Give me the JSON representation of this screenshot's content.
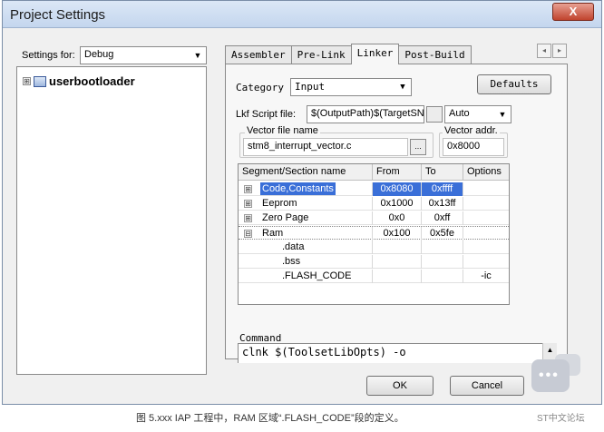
{
  "window": {
    "title": "Project Settings",
    "close_glyph": "X"
  },
  "settings_for": {
    "label": "Settings for:",
    "value": "Debug"
  },
  "tree": {
    "expander": "⊞",
    "root": "userbootloader"
  },
  "tabs": [
    {
      "label": "Assembler"
    },
    {
      "label": "Pre-Link"
    },
    {
      "label": "Linker"
    },
    {
      "label": "Post-Build"
    }
  ],
  "tab_scroll": {
    "left": "◂",
    "right": "▸"
  },
  "linker": {
    "category_label": "Category",
    "category_value": "Input",
    "defaults_button": "Defaults",
    "lkf_label": "Lkf Script file:",
    "lkf_value": "$(OutputPath)$(TargetSName",
    "lkf_mode": "Auto",
    "vector_file_label": "Vector file name",
    "vector_file_value": "stm8_interrupt_vector.c",
    "browse_label": "...",
    "vector_addr_label": "Vector addr.",
    "vector_addr_value": "0x8000"
  },
  "segments": {
    "headers": [
      "Segment/Section name",
      "From",
      "To",
      "Options"
    ],
    "rows": [
      {
        "exp": "⊞",
        "name": "Code,Constants",
        "from": "0x8080",
        "to": "0xffff",
        "opt": ""
      },
      {
        "exp": "⊞",
        "name": "Eeprom",
        "from": "0x1000",
        "to": "0x13ff",
        "opt": ""
      },
      {
        "exp": "⊞",
        "name": "Zero Page",
        "from": "0x0",
        "to": "0xff",
        "opt": ""
      },
      {
        "exp": "⊟",
        "name": "Ram",
        "from": "0x100",
        "to": "0x5fe",
        "opt": ""
      },
      {
        "exp": "",
        "name": ".data",
        "from": "",
        "to": "",
        "opt": ""
      },
      {
        "exp": "",
        "name": ".bss",
        "from": "",
        "to": "",
        "opt": ""
      },
      {
        "exp": "",
        "name": ".FLASH_CODE",
        "from": "",
        "to": "",
        "opt": "-ic"
      }
    ]
  },
  "command": {
    "label": "Command",
    "text": "clnk $(ToolsetLibOpts) -o"
  },
  "dialog_buttons": {
    "ok": "OK",
    "cancel": "Cancel"
  },
  "caption": "图 5.xxx IAP 工程中，RAM 区域“.FLASH_CODE”段的定义。",
  "watermark": "ST中文论坛"
}
